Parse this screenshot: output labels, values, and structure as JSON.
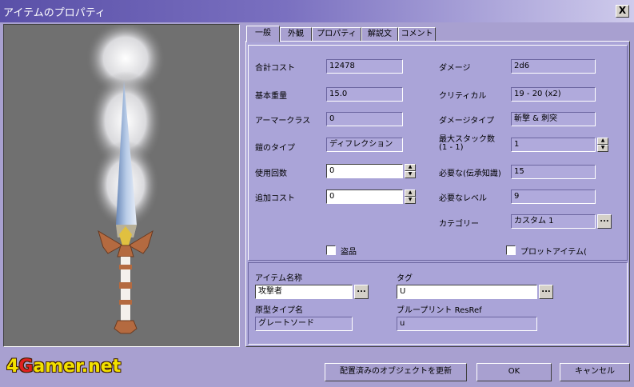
{
  "window": {
    "title": "アイテムのプロパティ",
    "close_label": "X"
  },
  "tabs": [
    {
      "label": "一般",
      "active": true
    },
    {
      "label": "外観",
      "active": false
    },
    {
      "label": "プロパティ",
      "active": false
    },
    {
      "label": "解説文",
      "active": false
    },
    {
      "label": "コメント",
      "active": false
    }
  ],
  "general": {
    "cost_label": "合計コスト",
    "cost_value": "12478",
    "weight_label": "基本重量",
    "weight_value": "15.0",
    "ac_label": "アーマークラス",
    "ac_value": "0",
    "ac_type_label": "鎧のタイプ",
    "ac_type_value": "ディフレクション",
    "charges_label": "使用回数",
    "charges_value": "0",
    "addcost_label": "追加コスト",
    "addcost_value": "0",
    "damage_label": "ダメージ",
    "damage_value": "2d6",
    "critical_label": "クリティカル",
    "critical_value": "19 - 20 (x2)",
    "damagetype_label": "ダメージタイプ",
    "damagetype_value": "斬撃 & 刺突",
    "stack_label": "最大スタック数",
    "stack_range": "(1 - 1)",
    "stack_value": "1",
    "lore_label": "必要な(伝承知識)",
    "lore_value": "15",
    "level_label": "必要なレベル",
    "level_value": "9",
    "category_label": "カテゴリー",
    "category_value": "カスタム 1",
    "stolen_label": "盗品",
    "stolen_checked": false,
    "plot_label": "プロットアイテム(",
    "plot_checked": false
  },
  "naming": {
    "name_label": "アイテム名称",
    "name_value": "攻撃者",
    "tag_label": "タグ",
    "tag_value": "U",
    "base_label": "原型タイプ名",
    "base_value": "グレートソード",
    "resref_label": "ブループリント ResRef",
    "resref_value": "u",
    "ellipsis": "..."
  },
  "buttons": {
    "update": "配置済みのオブジェクトを更新",
    "ok": "OK",
    "cancel": "キャンセル"
  },
  "watermark": {
    "part1": "4",
    "part2": "G",
    "part3": "amer.net"
  }
}
